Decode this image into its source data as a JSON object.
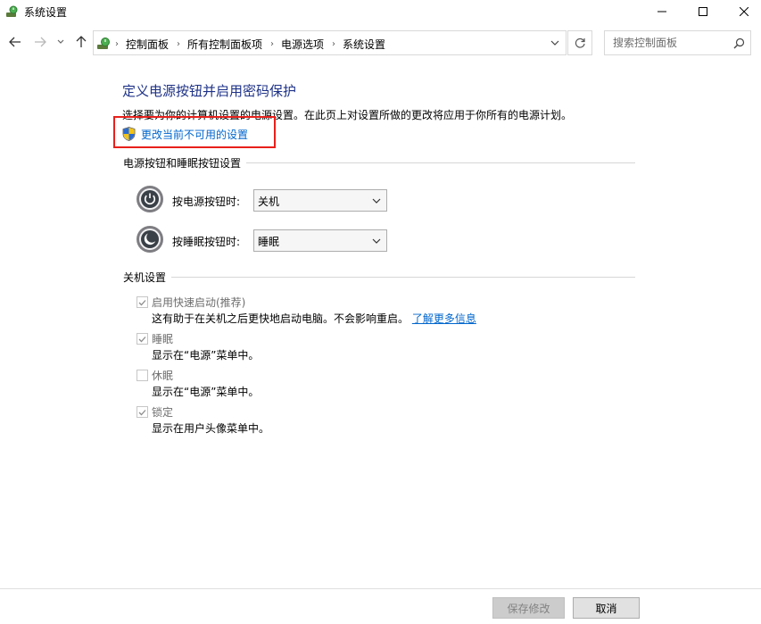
{
  "window": {
    "title": "系统设置",
    "icon": "power-options-icon",
    "controls": [
      "minimize",
      "maximize",
      "close"
    ]
  },
  "nav": {
    "breadcrumbs": [
      "控制面板",
      "所有控制面板项",
      "电源选项",
      "系统设置"
    ],
    "search_placeholder": "搜索控制面板"
  },
  "main": {
    "title": "定义电源按钮并启用密码保护",
    "description": "选择要为你的计算机设置的电源设置。在此页上对设置所做的更改将应用于你所有的电源计划。",
    "change_link": "更改当前不可用的设置",
    "highlight_color": "#e8201b"
  },
  "power_section": {
    "heading": "电源按钮和睡眠按钮设置",
    "power_button": {
      "label": "按电源按钮时:",
      "value": "关机"
    },
    "sleep_button": {
      "label": "按睡眠按钮时:",
      "value": "睡眠"
    }
  },
  "shutdown_section": {
    "heading": "关机设置",
    "options": [
      {
        "label": "启用快速启动(推荐)",
        "checked": true,
        "desc": "这有助于在关机之后更快地启动电脑。不会影响重启。",
        "link": "了解更多信息"
      },
      {
        "label": "睡眠",
        "checked": true,
        "desc": "显示在“电源”菜单中。"
      },
      {
        "label": "休眠",
        "checked": false,
        "desc": "显示在“电源”菜单中。"
      },
      {
        "label": "锁定",
        "checked": true,
        "desc": "显示在用户头像菜单中。"
      }
    ]
  },
  "footer": {
    "save_label": "保存修改",
    "cancel_label": "取消"
  },
  "colors": {
    "link": "#0066cc",
    "title": "#1e3287",
    "disabled_text": "#6d6d6d"
  }
}
